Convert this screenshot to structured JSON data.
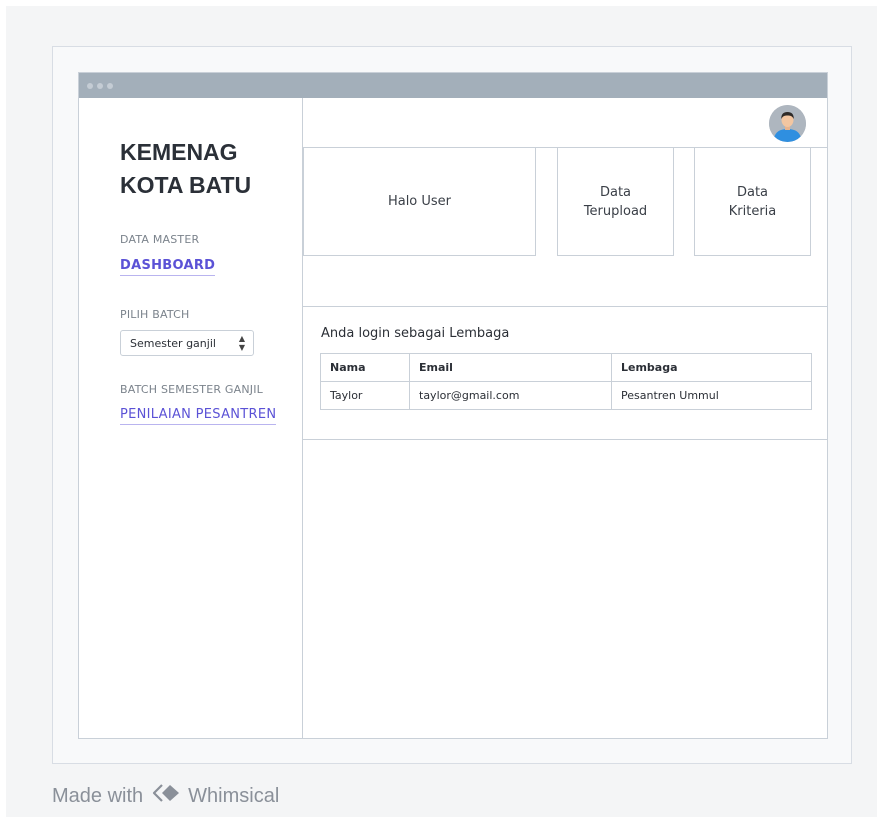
{
  "app": {
    "brand_line1": "KEMENAG",
    "brand_line2": "KOTA BATU"
  },
  "sidebar": {
    "data_master_label": "DATA MASTER",
    "dashboard_link": "DASHBOARD",
    "pilih_batch_label": "PILIH BATCH",
    "batch_select_value": "Semester ganjil",
    "batch_section_label": "BATCH SEMESTER GANJIL",
    "penilaian_link": "PENILAIAN PESANTREN"
  },
  "cards": {
    "greeting": "Halo User",
    "uploaded_line1": "Data",
    "uploaded_line2": "Terupload",
    "criteria_line1": "Data",
    "criteria_line2": "Kriteria"
  },
  "info": {
    "title": "Anda login sebagai Lembaga",
    "columns": [
      "Nama",
      "Email",
      "Lembaga"
    ],
    "rows": [
      [
        "Taylor",
        "taylor@gmail.com",
        "Pesantren Ummul"
      ]
    ]
  },
  "footer": {
    "made_with": "Made with",
    "brand": "Whimsical"
  },
  "icons": {
    "avatar": "user-avatar-icon",
    "window_dots": "window-dots-icon",
    "select_arrow": "updown-arrow-icon",
    "whimsical_logo": "whimsical-logo-icon"
  },
  "colors": {
    "accent_link": "#5b52d6",
    "titlebar": "#a3afba",
    "border": "#c9d0d8"
  }
}
